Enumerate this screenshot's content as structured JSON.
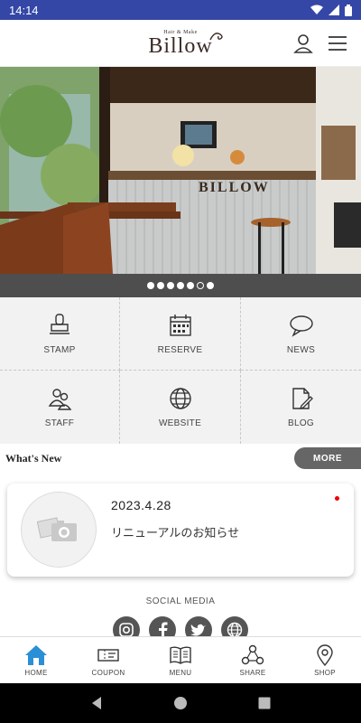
{
  "status_bar": {
    "time": "14:14"
  },
  "header": {
    "logo_small": "Hair & Make",
    "logo_main": "Billow"
  },
  "hero": {
    "sign_text": "BILLOW",
    "slide_count": 7,
    "active_slide": 6
  },
  "menu": [
    {
      "label": "STAMP",
      "icon": "stamp-icon"
    },
    {
      "label": "RESERVE",
      "icon": "calendar-icon"
    },
    {
      "label": "NEWS",
      "icon": "speech-bubble-icon"
    },
    {
      "label": "STAFF",
      "icon": "staff-icon"
    },
    {
      "label": "WEBSITE",
      "icon": "globe-icon"
    },
    {
      "label": "BLOG",
      "icon": "document-edit-icon"
    }
  ],
  "whats_new": {
    "title": "What's New",
    "more_label": "MORE"
  },
  "news": [
    {
      "date": "2023.4.28",
      "title": "リニューアルのお知らせ",
      "unread": true
    }
  ],
  "social": {
    "title": "SOCIAL MEDIA",
    "items": [
      {
        "icon": "instagram-icon"
      },
      {
        "icon": "facebook-icon"
      },
      {
        "icon": "twitter-icon"
      },
      {
        "icon": "globe-icon"
      }
    ]
  },
  "tabs": [
    {
      "label": "HOME",
      "icon": "home-icon",
      "active": true
    },
    {
      "label": "COUPON",
      "icon": "coupon-icon",
      "active": false
    },
    {
      "label": "MENU",
      "icon": "book-icon",
      "active": false
    },
    {
      "label": "SHARE",
      "icon": "share-icon",
      "active": false
    },
    {
      "label": "SHOP",
      "icon": "map-pin-icon",
      "active": false
    }
  ],
  "colors": {
    "status_bar": "#3547a6",
    "tab_active": "#2a8fd6",
    "more_button": "#666666",
    "unread_dot": "#e00000"
  }
}
